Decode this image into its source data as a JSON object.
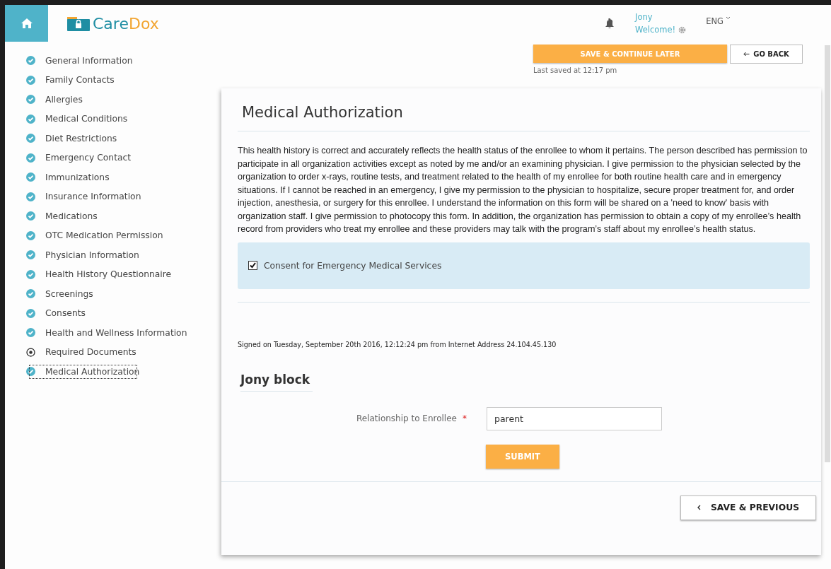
{
  "header": {
    "brand_part1": "Care",
    "brand_part2": "Dox",
    "user_name": "Jony",
    "welcome": "Welcome!",
    "language": "ENG"
  },
  "sidebar": {
    "items": [
      {
        "label": "General Information",
        "complete": true,
        "selected": false
      },
      {
        "label": "Family Contacts",
        "complete": true,
        "selected": false
      },
      {
        "label": "Allergies",
        "complete": true,
        "selected": false
      },
      {
        "label": "Medical Conditions",
        "complete": true,
        "selected": false
      },
      {
        "label": "Diet Restrictions",
        "complete": true,
        "selected": false
      },
      {
        "label": "Emergency Contact",
        "complete": true,
        "selected": false
      },
      {
        "label": "Immunizations",
        "complete": true,
        "selected": false
      },
      {
        "label": "Insurance Information",
        "complete": true,
        "selected": false
      },
      {
        "label": "Medications",
        "complete": true,
        "selected": false
      },
      {
        "label": "OTC Medication Permission",
        "complete": true,
        "selected": false
      },
      {
        "label": "Physician Information",
        "complete": true,
        "selected": false
      },
      {
        "label": "Health History Questionnaire",
        "complete": true,
        "selected": false
      },
      {
        "label": "Screenings",
        "complete": true,
        "selected": false
      },
      {
        "label": "Consents",
        "complete": true,
        "selected": false
      },
      {
        "label": "Health and Wellness Information",
        "complete": true,
        "selected": false
      },
      {
        "label": "Required Documents",
        "complete": false,
        "selected": false
      },
      {
        "label": "Medical Authorization",
        "complete": true,
        "selected": true
      }
    ]
  },
  "toolbar": {
    "save_later": "SAVE & CONTINUE LATER",
    "go_back": "GO BACK",
    "last_saved": "Last saved at 12:17 pm"
  },
  "form": {
    "title": "Medical Authorization",
    "statement": "This health history is correct and accurately reflects the health status of the enrollee to whom it pertains. The person described has permission to participate in all organization activities except as noted by me and/or an examining physician. I give permission to the physician selected by the organization to order x-rays, routine tests, and treatment related to the health of my enrollee for both routine health care and in emergency situations. If I cannot be reached in an emergency, I give my permission to the physician to hospitalize, secure proper treatment for, and order injection, anesthesia, or surgery for this enrollee. I understand the information on this form will be shared on a 'need to know' basis with organization staff. I give permission to photocopy this form. In addition, the organization has permission to obtain a copy of my enrollee’s health record from providers who treat my enrollee and these providers may talk with the program’s staff about my enrollee’s health status.",
    "consent": {
      "label": "Consent for Emergency Medical Services",
      "checked": true
    },
    "signed": "Signed on Tuesday, September 20th 2016, 12:12:24 pm from Internet Address 24.104.45.130",
    "signature": "Jony block",
    "relationship": {
      "label": "Relationship to Enrollee",
      "required_mark": "*",
      "value": "parent"
    },
    "submit": "SUBMIT",
    "save_previous": "SAVE & PREVIOUS"
  }
}
